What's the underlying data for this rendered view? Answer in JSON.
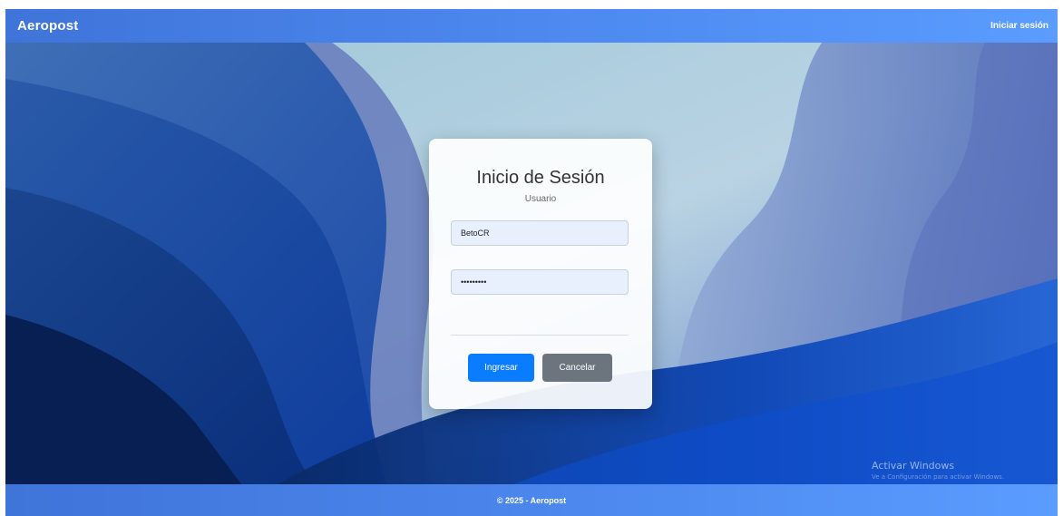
{
  "navbar": {
    "brand": "Aeropost",
    "login_link": "Iniciar sesión"
  },
  "login": {
    "title": "Inicio de Sesión",
    "subtitle": "Usuario",
    "username_value": "BetoCR",
    "password_value": "•••••••••",
    "submit_label": "Ingresar",
    "cancel_label": "Cancelar"
  },
  "footer": {
    "text": "© 2025 - Aeropost"
  },
  "watermark": {
    "title": "Activar Windows",
    "subtitle": "Ve a Configuración para activar Windows."
  },
  "colors": {
    "navbar": "#4b86ec",
    "primary_button": "#0a7cff",
    "secondary_button": "#6c757d"
  }
}
